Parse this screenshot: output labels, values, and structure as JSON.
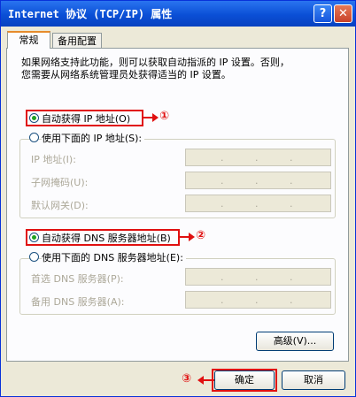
{
  "window": {
    "title": "Internet 协议 (TCP/IP) 属性",
    "help_label": "?",
    "close_label": "✕"
  },
  "tabs": [
    {
      "label": "常规",
      "active": true
    },
    {
      "label": "备用配置",
      "active": false
    }
  ],
  "description": "如果网络支持此功能，则可以获取自动指派的 IP 设置。否则，\n您需要从网络系统管理员处获得适当的 IP 设置。",
  "ip": {
    "auto_label": "自动获得 IP 地址(O)",
    "manual_label": "使用下面的 IP 地址(S):",
    "auto_selected": true,
    "fields": [
      {
        "label": "IP 地址(I):",
        "value": ""
      },
      {
        "label": "子网掩码(U):",
        "value": ""
      },
      {
        "label": "默认网关(D):",
        "value": ""
      }
    ]
  },
  "dns": {
    "auto_label": "自动获得 DNS 服务器地址(B)",
    "manual_label": "使用下面的 DNS 服务器地址(E):",
    "auto_selected": true,
    "fields": [
      {
        "label": "首选 DNS 服务器(P):",
        "value": ""
      },
      {
        "label": "备用 DNS 服务器(A):",
        "value": ""
      }
    ]
  },
  "buttons": {
    "advanced": "高级(V)...",
    "ok": "确定",
    "cancel": "取消"
  },
  "annotations": {
    "step1": "①",
    "step2": "②",
    "step3": "③"
  },
  "colors": {
    "title_bar": "#0a4fd6",
    "annotation_red": "#e01010",
    "radio_selected": "#21a121"
  }
}
